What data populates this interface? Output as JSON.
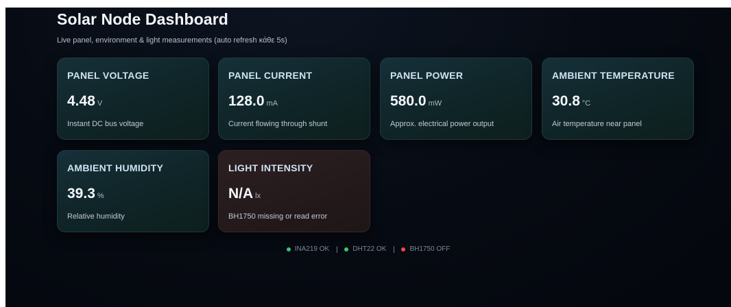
{
  "header": {
    "title": "Solar Node Dashboard",
    "subtitle": "Live panel, environment & light measurements (auto refresh κάθε 5s)"
  },
  "cards": [
    {
      "label": "PANEL VOLTAGE",
      "value": "4.48",
      "unit": "V",
      "description": "Instant DC bus voltage",
      "state": "ok"
    },
    {
      "label": "PANEL CURRENT",
      "value": "128.0",
      "unit": "mA",
      "description": "Current flowing through shunt",
      "state": "ok"
    },
    {
      "label": "PANEL POWER",
      "value": "580.0",
      "unit": "mW",
      "description": "Approx. electrical power output",
      "state": "ok"
    },
    {
      "label": "AMBIENT TEMPERATURE",
      "value": "30.8",
      "unit": "°C",
      "description": "Air temperature near panel",
      "state": "ok"
    },
    {
      "label": "AMBIENT HUMIDITY",
      "value": "39.3",
      "unit": "%",
      "description": "Relative humidity",
      "state": "ok"
    },
    {
      "label": "LIGHT INTENSITY",
      "value": "N/A",
      "unit": "lx",
      "description": "BH1750 missing or read error",
      "state": "error"
    }
  ],
  "status": {
    "separator": "|",
    "items": [
      {
        "label": "INA219 OK",
        "color": "#3ec46d"
      },
      {
        "label": "DHT22 OK",
        "color": "#3ec46d"
      },
      {
        "label": "BH1750 OFF",
        "color": "#f0484d"
      }
    ]
  }
}
